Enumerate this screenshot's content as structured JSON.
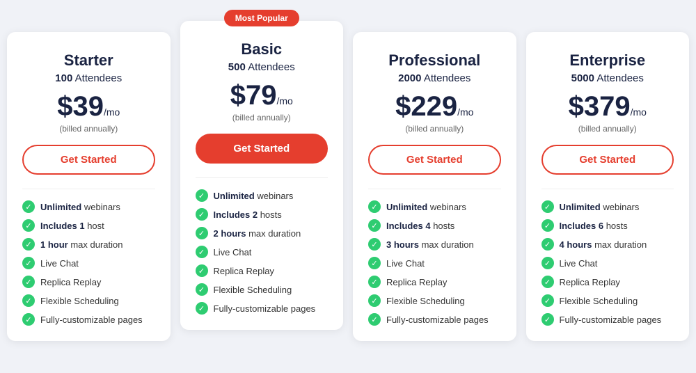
{
  "plans": [
    {
      "id": "starter",
      "name": "Starter",
      "attendees_count": "100",
      "attendees_label": "Attendees",
      "price": "$39",
      "per": "/mo",
      "billed": "(billed annually)",
      "cta": "Get Started",
      "cta_style": "outline",
      "popular": false,
      "features": [
        {
          "text": "webinars",
          "bold": "Unlimited"
        },
        {
          "text": "host",
          "bold": "Includes 1"
        },
        {
          "text": "max duration",
          "bold": "1 hour"
        },
        {
          "text": "Live Chat",
          "bold": ""
        },
        {
          "text": "Replica Replay",
          "bold": ""
        },
        {
          "text": "Flexible Scheduling",
          "bold": ""
        },
        {
          "text": "Fully-customizable pages",
          "bold": ""
        }
      ]
    },
    {
      "id": "basic",
      "name": "Basic",
      "attendees_count": "500",
      "attendees_label": "Attendees",
      "price": "$79",
      "per": "/mo",
      "billed": "(billed annually)",
      "cta": "Get Started",
      "cta_style": "filled",
      "popular": true,
      "popular_label": "Most Popular",
      "features": [
        {
          "text": "webinars",
          "bold": "Unlimited"
        },
        {
          "text": "hosts",
          "bold": "Includes 2"
        },
        {
          "text": "max duration",
          "bold": "2 hours"
        },
        {
          "text": "Live Chat",
          "bold": ""
        },
        {
          "text": "Replica Replay",
          "bold": ""
        },
        {
          "text": "Flexible Scheduling",
          "bold": ""
        },
        {
          "text": "Fully-customizable pages",
          "bold": ""
        }
      ]
    },
    {
      "id": "professional",
      "name": "Professional",
      "attendees_count": "2000",
      "attendees_label": "Attendees",
      "price": "$229",
      "per": "/mo",
      "billed": "(billed annually)",
      "cta": "Get Started",
      "cta_style": "outline",
      "popular": false,
      "features": [
        {
          "text": "webinars",
          "bold": "Unlimited"
        },
        {
          "text": "hosts",
          "bold": "Includes 4"
        },
        {
          "text": "max duration",
          "bold": "3 hours"
        },
        {
          "text": "Live Chat",
          "bold": ""
        },
        {
          "text": "Replica Replay",
          "bold": ""
        },
        {
          "text": "Flexible Scheduling",
          "bold": ""
        },
        {
          "text": "Fully-customizable pages",
          "bold": ""
        }
      ]
    },
    {
      "id": "enterprise",
      "name": "Enterprise",
      "attendees_count": "5000",
      "attendees_label": "Attendees",
      "price": "$379",
      "per": "/mo",
      "billed": "(billed annually)",
      "cta": "Get Started",
      "cta_style": "outline",
      "popular": false,
      "features": [
        {
          "text": "webinars",
          "bold": "Unlimited"
        },
        {
          "text": "hosts",
          "bold": "Includes 6"
        },
        {
          "text": "max duration",
          "bold": "4 hours"
        },
        {
          "text": "Live Chat",
          "bold": ""
        },
        {
          "text": "Replica Replay",
          "bold": ""
        },
        {
          "text": "Flexible Scheduling",
          "bold": ""
        },
        {
          "text": "Fully-customizable pages",
          "bold": ""
        }
      ]
    }
  ],
  "colors": {
    "red": "#e53e2e",
    "dark": "#1a2342",
    "green": "#2ecc71"
  }
}
